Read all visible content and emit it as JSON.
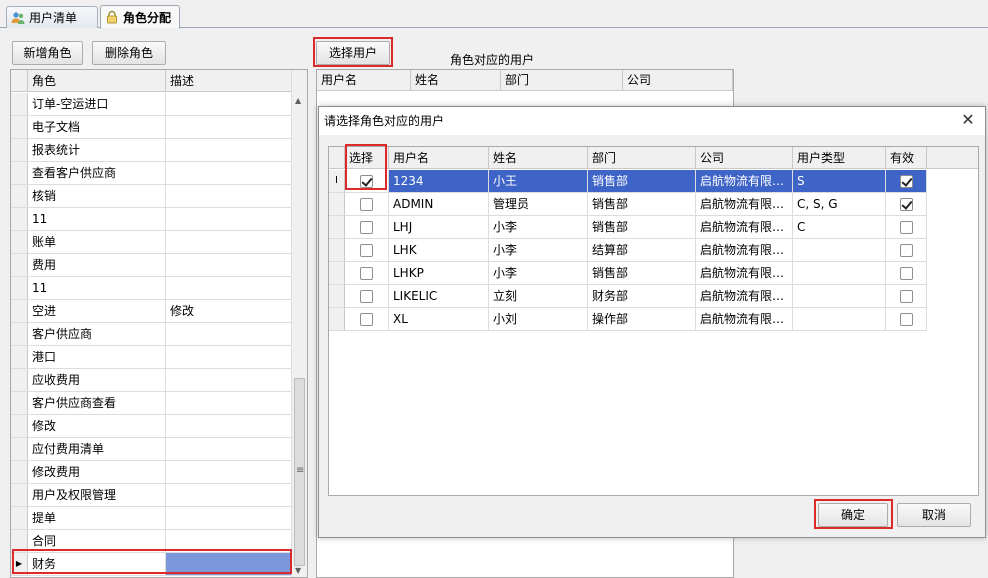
{
  "tabs": [
    {
      "label": "用户清单",
      "icon": "users-icon"
    },
    {
      "label": "角色分配",
      "icon": "lock-icon"
    }
  ],
  "toolbar": {
    "add_role": "新增角色",
    "delete_role": "删除角色",
    "select_user": "选择用户"
  },
  "role_grid": {
    "columns": [
      "角色",
      "描述"
    ],
    "rows": [
      {
        "role": "订单-空运进口",
        "desc": ""
      },
      {
        "role": "电子文档",
        "desc": ""
      },
      {
        "role": "报表统计",
        "desc": ""
      },
      {
        "role": "查看客户供应商",
        "desc": ""
      },
      {
        "role": "核销",
        "desc": ""
      },
      {
        "role": "11",
        "desc": ""
      },
      {
        "role": "账单",
        "desc": ""
      },
      {
        "role": "费用",
        "desc": ""
      },
      {
        "role": "11",
        "desc": ""
      },
      {
        "role": "空进",
        "desc": "修改"
      },
      {
        "role": "客户供应商",
        "desc": ""
      },
      {
        "role": "港口",
        "desc": ""
      },
      {
        "role": "应收费用",
        "desc": ""
      },
      {
        "role": "客户供应商查看",
        "desc": ""
      },
      {
        "role": "修改",
        "desc": ""
      },
      {
        "role": "应付费用清单",
        "desc": ""
      },
      {
        "role": "修改费用",
        "desc": ""
      },
      {
        "role": "用户及权限管理",
        "desc": ""
      },
      {
        "role": "提单",
        "desc": ""
      },
      {
        "role": "合同",
        "desc": ""
      },
      {
        "role": "财务",
        "desc": ""
      }
    ],
    "selected_index": 20
  },
  "role_users": {
    "label": "角色对应的用户",
    "columns": [
      "用户名",
      "姓名",
      "部门",
      "公司"
    ]
  },
  "dialog": {
    "title": "请选择角色对应的用户",
    "columns": [
      "选择",
      "用户名",
      "姓名",
      "部门",
      "公司",
      "用户类型",
      "有效"
    ],
    "rows": [
      {
        "selected": true,
        "username": "1234",
        "name": "小王",
        "dept": "销售部",
        "company": "启航物流有限…",
        "type": "S",
        "valid": true
      },
      {
        "selected": false,
        "username": "ADMIN",
        "name": "管理员",
        "dept": "销售部",
        "company": "启航物流有限…",
        "type": "C, S, G",
        "valid": true
      },
      {
        "selected": false,
        "username": "LHJ",
        "name": "小李",
        "dept": "销售部",
        "company": "启航物流有限…",
        "type": "C",
        "valid": false
      },
      {
        "selected": false,
        "username": "LHK",
        "name": "小李",
        "dept": "结算部",
        "company": "启航物流有限…",
        "type": "",
        "valid": false
      },
      {
        "selected": false,
        "username": "LHKP",
        "name": "小李",
        "dept": "销售部",
        "company": "启航物流有限…",
        "type": "",
        "valid": false
      },
      {
        "selected": false,
        "username": "LIKELIC",
        "name": "立刻",
        "dept": "财务部",
        "company": "启航物流有限…",
        "type": "",
        "valid": false
      },
      {
        "selected": false,
        "username": "XL",
        "name": "小刘",
        "dept": "操作部",
        "company": "启航物流有限…",
        "type": "",
        "valid": false
      }
    ],
    "current_row_marker": "I",
    "ok_label": "确定",
    "cancel_label": "取消"
  },
  "colors": {
    "highlight": "#d92b2b",
    "selection": "#3f64c8",
    "selected_cell": "#7d97dd"
  }
}
